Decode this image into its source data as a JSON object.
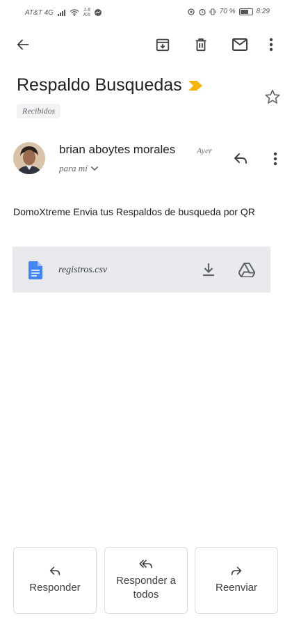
{
  "status_bar": {
    "carrier": "AT&T 4G",
    "speed_value": "1.8",
    "speed_unit": "K/s",
    "battery": "70 %",
    "time": "8:29"
  },
  "toolbar": {
    "icons": [
      "back-arrow-icon",
      "archive-icon",
      "trash-icon",
      "mail-icon",
      "more-vert-icon"
    ]
  },
  "email": {
    "subject": "Respaldo Busquedas",
    "important_color": "#f4b400",
    "label": "Recibidos",
    "sender": "brian aboytes morales",
    "time": "Ayer",
    "to": "para mí",
    "body": "DomoXtreme Envia tus Respaldos de busqueda por QR",
    "attachment": {
      "name": "registros.csv",
      "file_icon_color": "#4285f4"
    }
  },
  "actions": {
    "reply": "Responder",
    "reply_all": "Responder a todos",
    "forward": "Reenviar"
  }
}
